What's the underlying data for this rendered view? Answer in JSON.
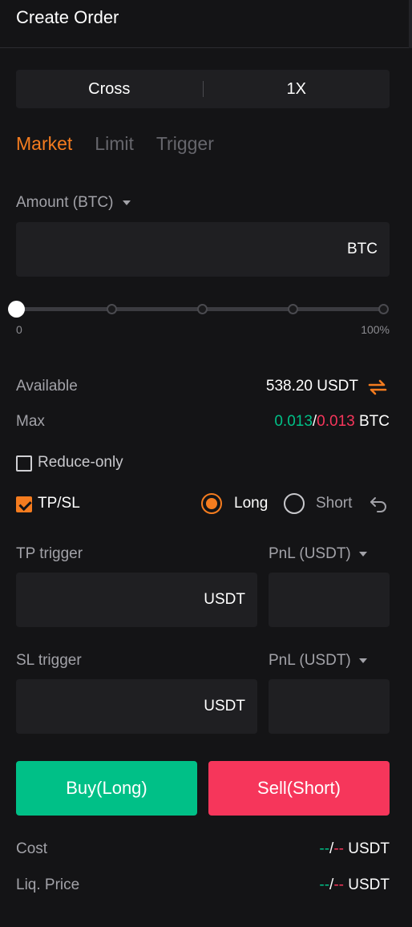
{
  "header": {
    "title": "Create Order"
  },
  "margin_mode": {
    "mode": "Cross",
    "leverage": "1X"
  },
  "order_types": {
    "market": "Market",
    "limit": "Limit",
    "trigger": "Trigger",
    "active": "Market"
  },
  "amount": {
    "label": "Amount (BTC)",
    "unit": "BTC",
    "value": ""
  },
  "slider": {
    "min_label": "0",
    "max_label": "100%",
    "value_percent": 0,
    "marks": [
      0,
      25,
      50,
      75,
      100
    ]
  },
  "available": {
    "label": "Available",
    "value": "538.20 USDT"
  },
  "max": {
    "label": "Max",
    "long_value": "0.013",
    "separator": "/",
    "short_value": "0.013",
    "unit": "BTC"
  },
  "reduce_only": {
    "label": "Reduce-only",
    "checked": false
  },
  "tpsl": {
    "label": "TP/SL",
    "checked": true,
    "long_label": "Long",
    "short_label": "Short",
    "selected": "Long"
  },
  "tp": {
    "label": "TP trigger",
    "unit": "USDT",
    "pnl_label": "PnL (USDT)"
  },
  "sl": {
    "label": "SL trigger",
    "unit": "USDT",
    "pnl_label": "PnL (USDT)"
  },
  "buttons": {
    "buy": "Buy(Long)",
    "sell": "Sell(Short)"
  },
  "cost": {
    "label": "Cost",
    "long_value": "--",
    "separator": "/",
    "short_value": "--",
    "unit": "USDT"
  },
  "liq_price": {
    "label": "Liq. Price",
    "long_value": "--",
    "separator": "/",
    "short_value": "--",
    "unit": "USDT"
  },
  "colors": {
    "accent": "#f57c1f",
    "long": "#00c087",
    "short": "#f6365b",
    "background": "#141416",
    "field": "#1f1f22"
  },
  "icons": {
    "swap": "swap-arrows-icon",
    "caret": "caret-down-icon",
    "reset": "undo-icon"
  }
}
